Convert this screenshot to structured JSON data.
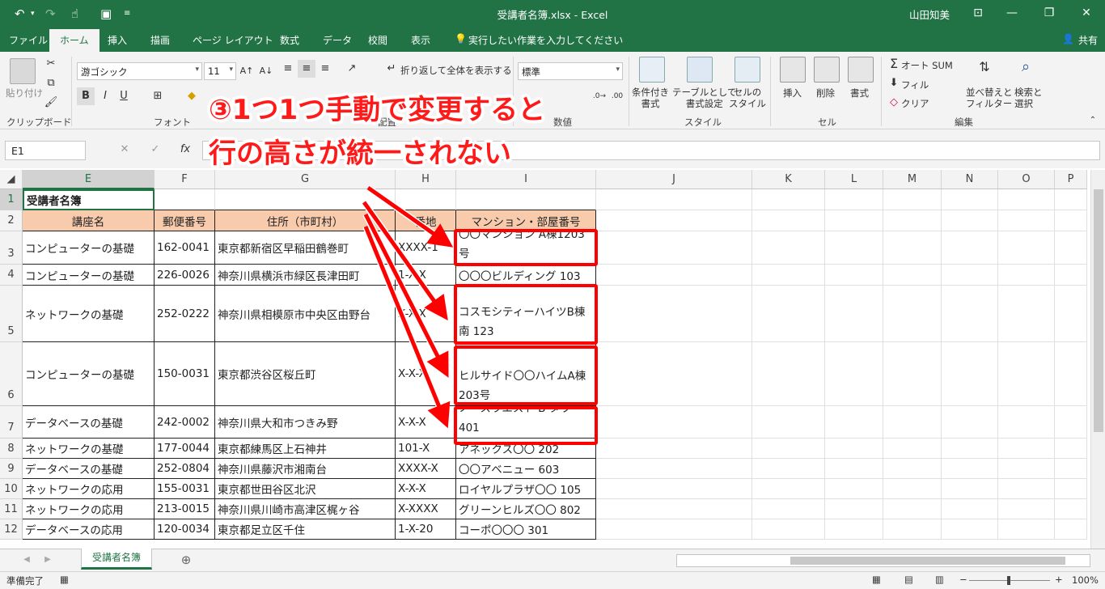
{
  "window": {
    "title": "受講者名簿.xlsx - Excel",
    "user": "山田知美"
  },
  "tabs": [
    "ファイル",
    "ホーム",
    "挿入",
    "描画",
    "ページ レイアウト",
    "数式",
    "データ",
    "校閲",
    "表示"
  ],
  "tell_me": "実行したい作業を入力してください",
  "share": "共有",
  "ribbon": {
    "paste": "貼り付け",
    "clipboard": "クリップボード",
    "font_name": "游ゴシック",
    "font_size": "11",
    "font": "フォント",
    "wrap_text": "折り返して全体を表示する",
    "alignment": "配置",
    "number_format": "標準",
    "number": "数値",
    "cond_format": "条件付き\n書式",
    "table_format": "テーブルとして\n書式設定",
    "cell_styles": "セルの\nスタイル",
    "styles": "スタイル",
    "insert": "挿入",
    "delete": "削除",
    "format": "書式",
    "cells": "セル",
    "autosum": "オート SUM",
    "fill": "フィル",
    "clear": "クリア",
    "sort_filter": "並べ替えと\nフィルター",
    "find_select": "検索と\n選択",
    "editing": "編集"
  },
  "namebox": "E1",
  "columns": [
    "E",
    "F",
    "G",
    "H",
    "I",
    "J",
    "K",
    "L",
    "M",
    "N",
    "O",
    "P"
  ],
  "rows": [
    {
      "n": "1",
      "cells": [
        "受講者名簿",
        "",
        "",
        "",
        ""
      ]
    },
    {
      "n": "2",
      "cells": [
        "講座名",
        "郵便番号",
        "住所（市町村）",
        "番地",
        "マンション・部屋番号"
      ]
    },
    {
      "n": "3",
      "cells": [
        "コンピューターの基礎",
        "162-0041",
        "東京都新宿区早稲田鶴巻町",
        "XXXX-1",
        "〇〇マンション A棟1203号"
      ]
    },
    {
      "n": "4",
      "cells": [
        "コンピューターの基礎",
        "226-0026",
        "神奈川県横浜市緑区長津田町",
        "1-X-X",
        "〇〇〇ビルディング 103"
      ]
    },
    {
      "n": "5",
      "cells": [
        "ネットワークの基礎",
        "252-0222",
        "神奈川県相模原市中央区由野台",
        "X-X-X",
        "コスモシティーハイツB棟南 123"
      ]
    },
    {
      "n": "6",
      "cells": [
        "コンピューターの基礎",
        "150-0031",
        "東京都渋谷区桜丘町",
        "X-X-X",
        "ヒルサイド〇〇ハイムA棟 203号"
      ]
    },
    {
      "n": "7",
      "cells": [
        "データベースの基礎",
        "242-0002",
        "神奈川県大和市つきみ野",
        "X-X-X",
        "ノースウエスト B タワー401"
      ]
    },
    {
      "n": "8",
      "cells": [
        "ネットワークの基礎",
        "177-0044",
        "東京都練馬区上石神井",
        "101-X",
        "アネックス〇〇 202"
      ]
    },
    {
      "n": "9",
      "cells": [
        "データベースの基礎",
        "252-0804",
        "神奈川県藤沢市湘南台",
        "XXXX-X",
        "〇〇アベニュー 603"
      ]
    },
    {
      "n": "10",
      "cells": [
        "ネットワークの応用",
        "155-0031",
        "東京都世田谷区北沢",
        "X-X-X",
        "ロイヤルプラザ〇〇 105"
      ]
    },
    {
      "n": "11",
      "cells": [
        "ネットワークの応用",
        "213-0015",
        "神奈川県川崎市高津区梶ヶ谷",
        "X-XXXX",
        "グリーンヒルズ〇〇 802"
      ]
    },
    {
      "n": "12",
      "cells": [
        "データベースの応用",
        "120-0034",
        "東京都足立区千住",
        "1-X-20",
        "コーポ〇〇〇 301"
      ]
    }
  ],
  "callout": {
    "line1": "③1つ1つ手動で変更すると",
    "line2": "行の高さが統一されない"
  },
  "sheet_tab": "受講者名簿",
  "status": {
    "ready": "準備完了",
    "zoom": "100%"
  },
  "colors": {
    "accent": "#217346",
    "header_fill": "#f8cbad",
    "highlight": "#ff0000"
  }
}
